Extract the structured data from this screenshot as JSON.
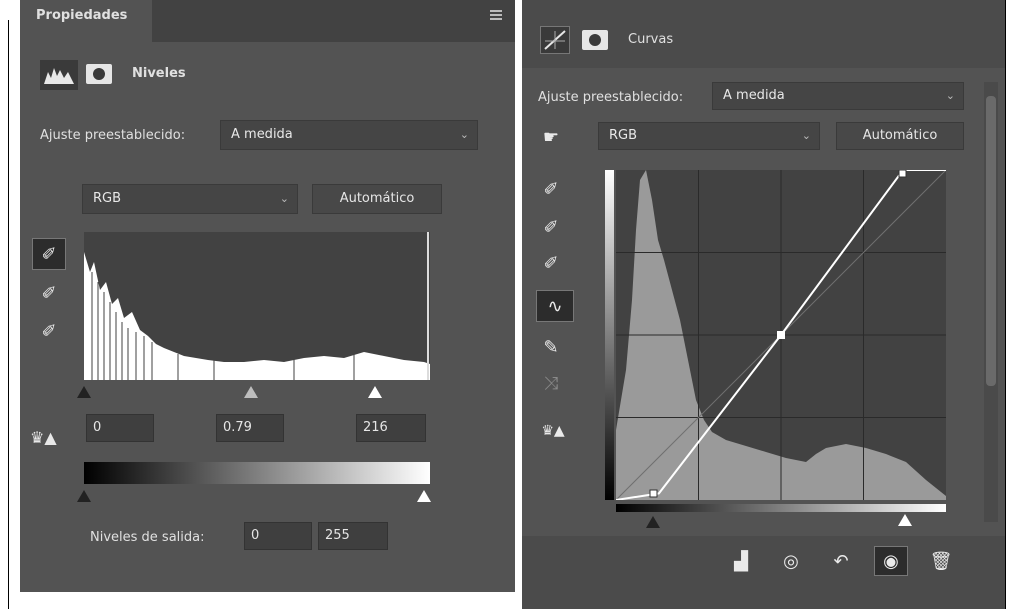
{
  "left": {
    "tab_label": "Propiedades",
    "menu_icon": "menu-icon",
    "panel_title": "Niveles",
    "preset_label": "Ajuste preestablecido:",
    "preset_value": "A medida",
    "channel_value": "RGB",
    "auto_label": "Automático",
    "input_black": "0",
    "input_mid": "0.79",
    "input_white": "216",
    "output_label": "Niveles de salida:",
    "output_black": "0",
    "output_white": "255"
  },
  "right": {
    "panel_title": "Curvas",
    "preset_label": "Ajuste preestablecido:",
    "preset_value": "A medida",
    "channel_value": "RGB",
    "auto_label": "Automático",
    "curve_points": [
      [
        0,
        0
      ],
      [
        0.13,
        0.02
      ],
      [
        0.5,
        0.5
      ],
      [
        0.87,
        1
      ],
      [
        1,
        1
      ]
    ]
  },
  "colors": {
    "panel_bg": "#535353",
    "dark_bg": "#424242",
    "histogram_light": "#ffffff",
    "histogram_grey": "#9a9a9a"
  }
}
